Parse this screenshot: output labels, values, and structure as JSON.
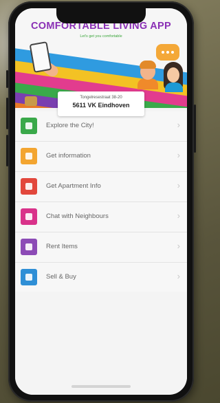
{
  "app": {
    "title": "COMFORTABLE LIVING APP",
    "subtitle": "Let's get you comfortable"
  },
  "address": {
    "street": "Tongelresestraat 38-20",
    "city": "5611 VK Eindhoven"
  },
  "menu": {
    "items": [
      {
        "label": "Explore the City!",
        "icon": "city-icon",
        "color": "#3aa94a"
      },
      {
        "label": "Get information",
        "icon": "info-icon",
        "color": "#f3a530"
      },
      {
        "label": "Get Apartment Info",
        "icon": "house-icon",
        "color": "#e2473c"
      },
      {
        "label": "Chat with Neighbours",
        "icon": "chat-icon",
        "color": "#d9328a"
      },
      {
        "label": "Rent Items",
        "icon": "person-icon",
        "color": "#8c4bb6"
      },
      {
        "label": "Sell & Buy",
        "icon": "cart-icon",
        "color": "#2f8fd6"
      }
    ],
    "chevron": "›"
  }
}
